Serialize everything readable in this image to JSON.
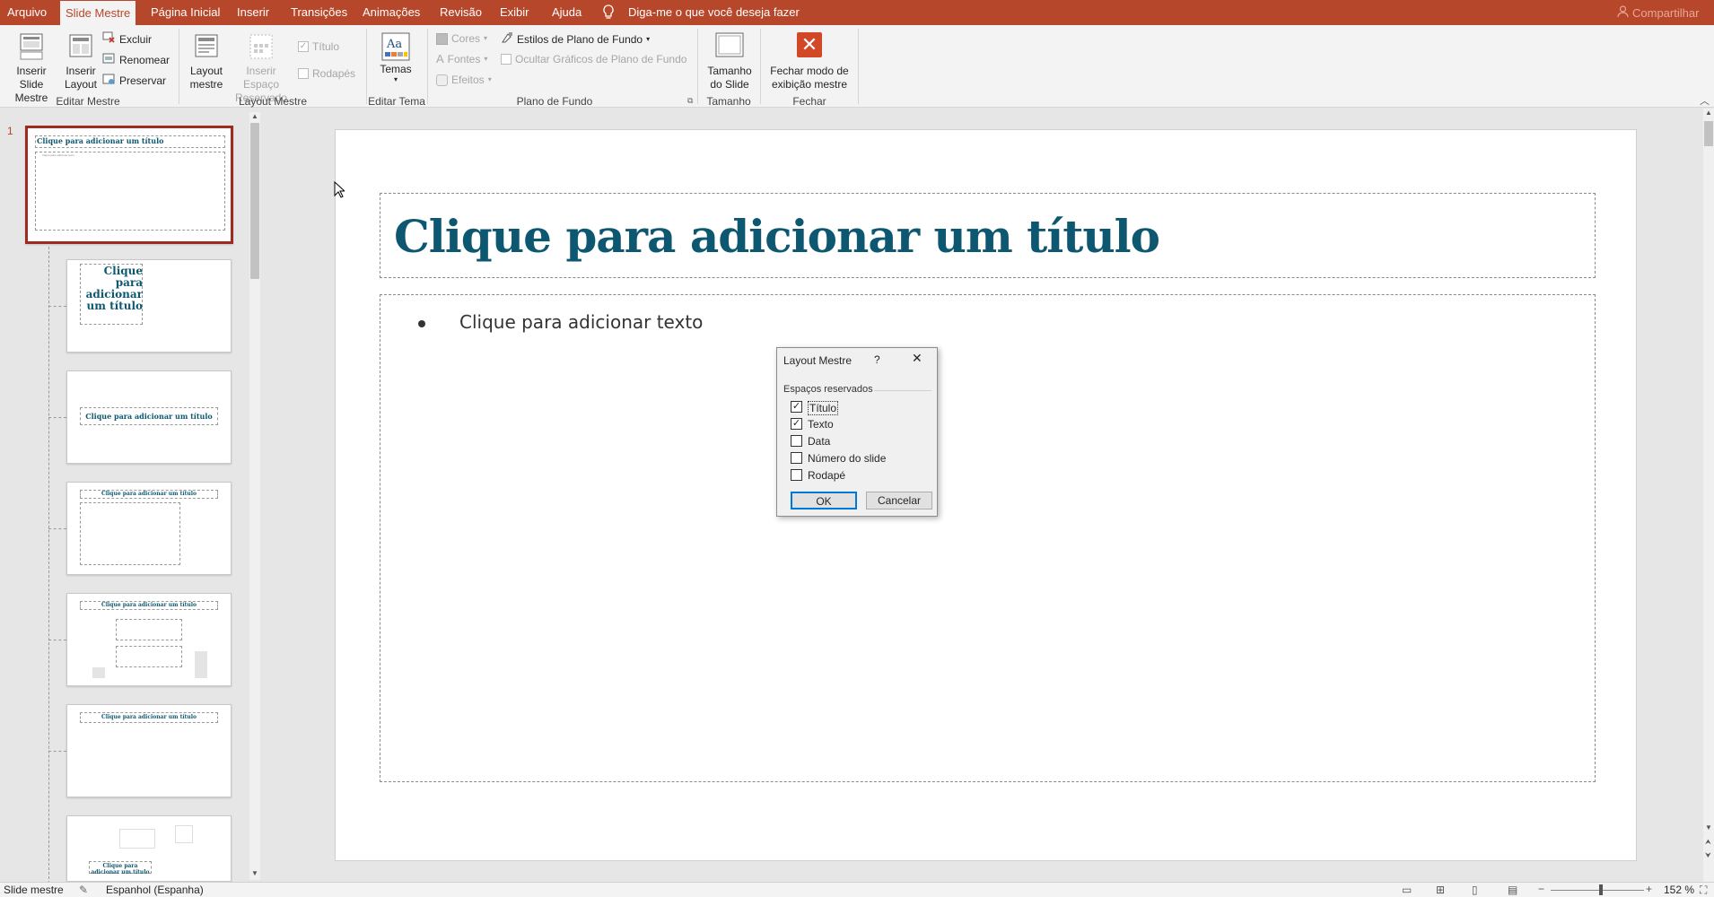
{
  "menu": {
    "tabs": [
      "Arquivo",
      "Slide Mestre",
      "Página Inicial",
      "Inserir",
      "Transições",
      "Animações",
      "Revisão",
      "Exibir",
      "Ajuda"
    ],
    "tell_me": "Diga-me o que você deseja fazer",
    "share": "Compartilhar"
  },
  "ribbon": {
    "insert_slide_master": "Inserir Slide Mestre",
    "insert_layout": "Inserir Layout",
    "delete": "Excluir",
    "rename": "Renomear",
    "preserve": "Preservar",
    "group_edit_master": "Editar Mestre",
    "master_layout": "Layout mestre",
    "insert_placeholder": "Inserir Espaço Reservado",
    "title_check": "Título",
    "footers_check": "Rodapés",
    "group_master_layout": "Layout Mestre",
    "themes": "Temas",
    "group_edit_theme": "Editar Tema",
    "colors": "Cores",
    "fonts": "Fontes",
    "effects": "Efeitos",
    "bg_styles": "Estilos de Plano de Fundo",
    "hide_bg": "Ocultar Gráficos de Plano de Fundo",
    "group_background": "Plano de Fundo",
    "slide_size": "Tamanho do Slide",
    "group_size": "Tamanho",
    "close_master": "Fechar modo de exibição mestre",
    "group_close": "Fechar"
  },
  "thumbnails": {
    "slide_number": "1",
    "master_title": "Clique para adicionar um título",
    "master_body": "Clique para adicionar texto",
    "layout2_title": "Clique para adicionar um título",
    "layout3_title": "Clique para adicionar um título",
    "layout4_title": "Clique para adicionar um título",
    "layout5_title": "Clique para adicionar um título",
    "layout6_title": "Clique para adicionar um título",
    "layout7_title": "Clique para adicionar um título"
  },
  "slide": {
    "title": "Clique para adicionar um título",
    "body": "Clique para adicionar texto"
  },
  "dialog": {
    "title": "Layout Mestre",
    "help": "?",
    "section": "Espaços reservados",
    "options": [
      {
        "label": "Título",
        "checked": true
      },
      {
        "label": "Texto",
        "checked": true
      },
      {
        "label": "Data",
        "checked": false
      },
      {
        "label": "Número do slide",
        "checked": false
      },
      {
        "label": "Rodapé",
        "checked": false
      }
    ],
    "ok": "OK",
    "cancel": "Cancelar"
  },
  "status": {
    "view": "Slide mestre",
    "language": "Espanhol (Espanha)",
    "zoom": "152 %"
  },
  "colors": {
    "accent": "#b7472a",
    "title_color": "#0d5870"
  }
}
